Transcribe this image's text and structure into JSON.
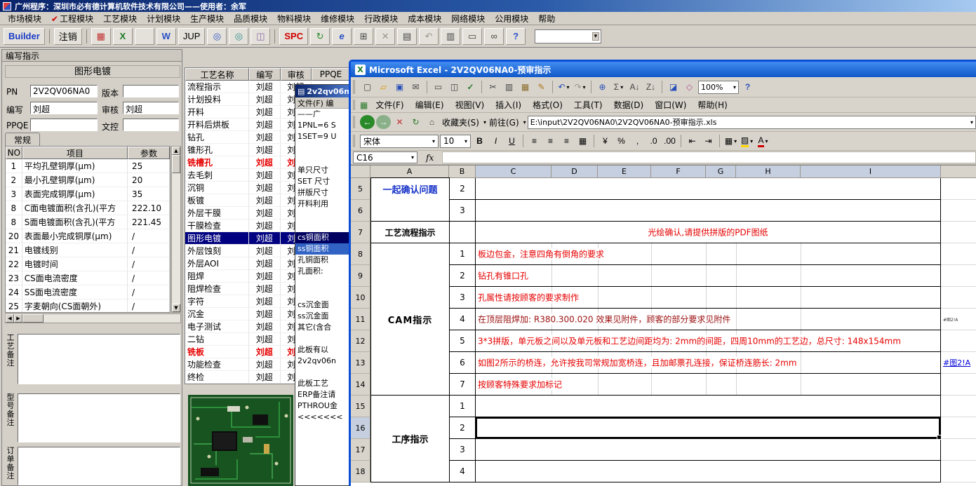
{
  "app": {
    "title": "广州程序：深圳市必有德计算机软件技术有限公司——使用者：余军",
    "menu_check": "✔",
    "menu": [
      {
        "label": "市场模块"
      },
      {
        "label": "工程模块",
        "checked": true
      },
      {
        "label": "工艺模块"
      },
      {
        "label": "计划模块"
      },
      {
        "label": "生产模块"
      },
      {
        "label": "品质模块"
      },
      {
        "label": "物料模块"
      },
      {
        "label": "维修模块"
      },
      {
        "label": "行政模块"
      },
      {
        "label": "成本模块"
      },
      {
        "label": "网络模块"
      },
      {
        "label": "公用模块"
      },
      {
        "label": "帮助"
      }
    ],
    "toolbar": {
      "items": [
        {
          "name": "builder-button",
          "text": "Builder",
          "color": "#1a3cc8",
          "bold": true
        },
        {
          "sep": true
        },
        {
          "name": "logout-button",
          "text": "注销"
        },
        {
          "sep": true
        },
        {
          "name": "grid-icon",
          "glyph": "▦",
          "color": "#c03030"
        },
        {
          "name": "excel-icon",
          "glyph": "X",
          "color": "#1a7a2a",
          "bold": true
        },
        {
          "name": "blank-icon",
          "glyph": ""
        },
        {
          "name": "word-icon",
          "glyph": "W",
          "color": "#2a50c8",
          "bold": true
        },
        {
          "name": "jup-button",
          "text": "JUP"
        },
        {
          "name": "preview-icon",
          "glyph": "◎",
          "color": "#2a50c8"
        },
        {
          "name": "view-icon",
          "glyph": "◎",
          "color": "#2a8a8a"
        },
        {
          "name": "column-icon",
          "glyph": "◫",
          "color": "#8a6aaa"
        },
        {
          "sep": true
        },
        {
          "name": "spc-button",
          "text": "SPC",
          "color": "#d00000",
          "bold": true
        },
        {
          "name": "refresh-icon",
          "glyph": "↻",
          "color": "#2a8a2a"
        },
        {
          "name": "ie-icon",
          "glyph": "e",
          "color": "#2a50c8",
          "bold": true,
          "italic": true
        },
        {
          "name": "calculator-icon",
          "glyph": "⊞",
          "color": "#444444"
        },
        {
          "name": "close-icon",
          "glyph": "✕",
          "color": "#9a968c"
        },
        {
          "name": "document-icon",
          "glyph": "▤",
          "color": "#444444"
        },
        {
          "name": "undo-icon",
          "glyph": "↶",
          "color": "#9a968c"
        },
        {
          "name": "sheet-icon",
          "glyph": "▥",
          "color": "#444444"
        },
        {
          "name": "print-icon",
          "glyph": "▭",
          "color": "#444444"
        },
        {
          "name": "find-icon",
          "glyph": "∞",
          "color": "#444444"
        },
        {
          "name": "help-icon",
          "glyph": "?",
          "color": "#2a50c8",
          "bold": true
        }
      ]
    }
  },
  "left_panel": {
    "caption": "编写指示",
    "group_title": "图形电镀",
    "fields": {
      "pn_label": "PN",
      "pn": "2V2QV06NA0",
      "version_label": "版本",
      "version": "",
      "writer_label": "编写",
      "writer": "刘超",
      "reviewer_label": "审核",
      "reviewer": "刘超",
      "ppqe_label": "PPQE",
      "ppqe": "",
      "doc_label": "文控",
      "doc": ""
    },
    "tab": "常规",
    "table": {
      "headers": [
        "NO",
        "项目",
        "参数"
      ],
      "rows": [
        [
          "1",
          "平均孔壁铜厚(μm)",
          "25"
        ],
        [
          "2",
          "最小孔壁铜厚(μm)",
          "20"
        ],
        [
          "3",
          "表面完成铜厚(μm)",
          "35"
        ],
        [
          "8",
          "C面电镀面积(含孔)(平方",
          "222.10"
        ],
        [
          "8",
          "S面电镀面积(含孔)(平方",
          "221.45"
        ],
        [
          "20",
          "表面最小完成铜厚(μm)",
          "/"
        ],
        [
          "21",
          "电镀线别",
          "/"
        ],
        [
          "22",
          "电镀时间",
          "/"
        ],
        [
          "23",
          "CS面电流密度",
          "/"
        ],
        [
          "24",
          "SS面电流密度",
          "/"
        ],
        [
          "25",
          "字麦朝向(CS面朝外)",
          "/"
        ]
      ]
    },
    "remarks": [
      {
        "label": "工艺备注"
      },
      {
        "label": "型号备注"
      },
      {
        "label": "订单备注"
      }
    ]
  },
  "process_table": {
    "headers": [
      "工艺名称",
      "编写",
      "审核",
      "PPQE"
    ],
    "rows": [
      {
        "name": "流程指示",
        "w": "刘超",
        "r": "刘超"
      },
      {
        "name": "计划投料",
        "w": "刘超",
        "r": "刘超"
      },
      {
        "name": "开料",
        "w": "刘超",
        "r": "刘超"
      },
      {
        "name": "开料后烘板",
        "w": "刘超",
        "r": "刘超"
      },
      {
        "name": "钻孔",
        "w": "刘超",
        "r": "刘超"
      },
      {
        "name": "锥形孔",
        "w": "刘超",
        "r": "刘超"
      },
      {
        "name": "铣槽孔",
        "w": "刘超",
        "r": "刘超",
        "red": true
      },
      {
        "name": "去毛刺",
        "w": "刘超",
        "r": "刘超"
      },
      {
        "name": "沉铜",
        "w": "刘超",
        "r": "刘超"
      },
      {
        "name": "板镀",
        "w": "刘超",
        "r": "刘超"
      },
      {
        "name": "外层干膜",
        "w": "刘超",
        "r": "刘超"
      },
      {
        "name": "干膜检查",
        "w": "刘超",
        "r": "刘超"
      },
      {
        "name": "图形电镀",
        "w": "刘超",
        "r": "刘超",
        "selected": true
      },
      {
        "name": "外层蚀刻",
        "w": "刘超",
        "r": "刘超"
      },
      {
        "name": "外层AOI",
        "w": "刘超",
        "r": "刘超"
      },
      {
        "name": "阻焊",
        "w": "刘超",
        "r": "刘超"
      },
      {
        "name": "阻焊检查",
        "w": "刘超",
        "r": "刘超"
      },
      {
        "name": "字符",
        "w": "刘超",
        "r": "刘超"
      },
      {
        "name": "沉金",
        "w": "刘超",
        "r": "刘超"
      },
      {
        "name": "电子测试",
        "w": "刘超",
        "r": "刘超"
      },
      {
        "name": "二钻",
        "w": "刘超",
        "r": "刘超"
      },
      {
        "name": "铣板",
        "w": "刘超",
        "r": "刘超",
        "red": true
      },
      {
        "name": "功能检查",
        "w": "刘超",
        "r": "刘超"
      },
      {
        "name": "终检",
        "w": "刘超",
        "r": "刘超"
      }
    ]
  },
  "notepad": {
    "title": "2v2qv06n",
    "menu": "文件(F) 编",
    "lines": [
      {
        "t": "——广"
      },
      {
        "t": "1PNL=6 S"
      },
      {
        "t": "1SET=9 U"
      },
      {
        "t": ""
      },
      {
        "t": ""
      },
      {
        "t": "单只尺寸"
      },
      {
        "t": "SET 尺寸"
      },
      {
        "t": "拼版尺寸"
      },
      {
        "t": "开料利用"
      },
      {
        "t": ""
      },
      {
        "t": ""
      },
      {
        "t": "cs铜面积",
        "hl": "dark"
      },
      {
        "t": "ss铜面积",
        "hl": "blue"
      },
      {
        "t": "孔铜面积"
      },
      {
        "t": "孔面积:"
      },
      {
        "t": ""
      },
      {
        "t": ""
      },
      {
        "t": "cs沉金面"
      },
      {
        "t": "ss沉金面"
      },
      {
        "t": "其它(含合"
      },
      {
        "t": ""
      },
      {
        "t": "此板有以"
      },
      {
        "t": "2v2qv06n"
      },
      {
        "t": ""
      },
      {
        "t": "此板工艺"
      },
      {
        "t": "ERP备注请"
      },
      {
        "t": "PTHROU金"
      },
      {
        "t": "<<<<<<<"
      }
    ]
  },
  "excel": {
    "title": "Microsoft Excel - 2V2QV06NA0-预审指示",
    "menu": [
      "文件(F)",
      "编辑(E)",
      "视图(V)",
      "插入(I)",
      "格式(O)",
      "工具(T)",
      "数据(D)",
      "窗口(W)",
      "帮助(H)"
    ],
    "zoom": "100%",
    "std_icons": [
      {
        "name": "new-document-icon",
        "glyph": "▢",
        "color": "#444444"
      },
      {
        "name": "open-folder-icon",
        "glyph": "▱",
        "color": "#d89a00"
      },
      {
        "name": "save-icon",
        "glyph": "▣",
        "color": "#2a50b8"
      },
      {
        "name": "email-icon",
        "glyph": "✉",
        "color": "#444444"
      },
      {
        "sep": true
      },
      {
        "name": "print-icon",
        "glyph": "▭",
        "color": "#444444"
      },
      {
        "name": "print-preview-icon",
        "glyph": "◫",
        "color": "#444444"
      },
      {
        "name": "spelling-icon",
        "glyph": "✓",
        "color": "#2a7a2a",
        "bold": true
      },
      {
        "sep": true
      },
      {
        "name": "cut-icon",
        "glyph": "✂",
        "color": "#444444"
      },
      {
        "name": "copy-icon",
        "glyph": "▥",
        "color": "#444444"
      },
      {
        "name": "paste-icon",
        "glyph": "▦",
        "color": "#8a6a2a"
      },
      {
        "name": "format-painter-icon",
        "glyph": "✎",
        "color": "#b07820"
      },
      {
        "sep": true
      },
      {
        "name": "undo-icon",
        "glyph": "↶",
        "color": "#2a50b8",
        "caret": true
      },
      {
        "name": "redo-icon",
        "glyph": "↷",
        "color": "#9a968c",
        "caret": true
      },
      {
        "sep": true
      },
      {
        "name": "hyperlink-icon",
        "glyph": "⊕",
        "color": "#2a50b8"
      },
      {
        "name": "autosum-icon",
        "glyph": "Σ",
        "color": "#444444",
        "caret": true
      },
      {
        "name": "sort-ascending-icon",
        "glyph": "A↓",
        "color": "#444444"
      },
      {
        "name": "sort-descending-icon",
        "glyph": "Z↓",
        "color": "#444444"
      },
      {
        "sep": true
      },
      {
        "name": "chart-wizard-icon",
        "glyph": "◪",
        "color": "#2a50b8"
      },
      {
        "name": "drawing-icon",
        "glyph": "◇",
        "color": "#b05090"
      },
      {
        "zoom": true
      },
      {
        "name": "help-icon",
        "glyph": "?",
        "color": "#2a50b8",
        "bold": true
      }
    ],
    "web": {
      "icons": [
        {
          "name": "back-icon",
          "glyph": "←",
          "bg": "#2a8a2a"
        },
        {
          "name": "forward-icon",
          "glyph": "→",
          "bg": "#8ab08a"
        },
        {
          "name": "stop-icon",
          "glyph": "✕",
          "color": "#c03030"
        },
        {
          "name": "refresh-icon",
          "glyph": "↻",
          "color": "#2a7a2a"
        },
        {
          "name": "home-icon",
          "glyph": "⌂",
          "color": "#444444"
        }
      ],
      "favorites": "收藏夹(S)",
      "go": "前往(G)",
      "address": "E:\\input\\2V2QV06NA0\\2V2QV06NA0-预审指示.xls"
    },
    "fmt": {
      "font": "宋体",
      "size": "10",
      "buttons": [
        {
          "name": "bold-button",
          "glyph": "B",
          "bold": true
        },
        {
          "name": "italic-button",
          "glyph": "I",
          "italic": true
        },
        {
          "name": "underline-button",
          "glyph": "U",
          "u": true
        },
        {
          "sep": true
        },
        {
          "name": "align-left-icon",
          "glyph": "≡"
        },
        {
          "name": "align-center-icon",
          "glyph": "≡"
        },
        {
          "name": "align-right-icon",
          "glyph": "≡"
        },
        {
          "name": "merge-center-icon",
          "glyph": "▦"
        },
        {
          "sep": true
        },
        {
          "name": "currency-icon",
          "glyph": "¥"
        },
        {
          "name": "percent-icon",
          "glyph": "%"
        },
        {
          "name": "comma-icon",
          "glyph": ","
        },
        {
          "name": "increase-decimal-icon",
          "glyph": ".0"
        },
        {
          "name": "decrease-decimal-icon",
          "glyph": ".00"
        },
        {
          "sep": true
        },
        {
          "name": "decrease-indent-icon",
          "glyph": "⇤"
        },
        {
          "name": "increase-indent-icon",
          "glyph": "⇥"
        },
        {
          "sep": true
        },
        {
          "name": "borders-icon",
          "glyph": "▦",
          "caret": true
        },
        {
          "name": "fill-color-icon",
          "glyph": "▨",
          "ul": "#ffd400",
          "caret": true
        },
        {
          "name": "font-color-icon",
          "glyph": "A",
          "ul": "#d00000",
          "caret": true
        }
      ]
    },
    "name_box": "C16",
    "fx_label": "fx",
    "columns": [
      "A",
      "B",
      "C",
      "D",
      "E",
      "F",
      "G",
      "H",
      "I"
    ],
    "a_blocks": {
      "confirm": "一起确认问题",
      "flow": "工艺流程指示",
      "cam": "CAM指示",
      "process": "工序指示"
    },
    "rows": [
      {
        "n": "5",
        "b": "2"
      },
      {
        "n": "6",
        "b": "3"
      },
      {
        "n": "7",
        "text": "光绘确认,请提供拼版的PDF图纸",
        "align": "center",
        "color": "#e60000"
      },
      {
        "n": "8",
        "b": "1",
        "sep": true,
        "text": "板边包金，注意四角有倒角的要求",
        "color": "#e60000"
      },
      {
        "n": "9",
        "b": "2",
        "sep": true,
        "text": "钻孔有锥口孔",
        "color": "#e60000"
      },
      {
        "n": "10",
        "b": "3",
        "sep": true,
        "text": "孔属性请按顾客的要求制作",
        "color": "#e60000"
      },
      {
        "n": "11",
        "b": "4",
        "sep": true,
        "text": "在顶层阻焊加: R380.300.020 效果见附件，顾客的部分要求见附件",
        "color": "#9b1010",
        "frag": "#图2!A"
      },
      {
        "n": "12",
        "b": "5",
        "sep": true,
        "text": "3*3拼版，单元板之间以及单元板和工艺边间距均为: 2mm的间距，四周10mm的工艺边，总尺寸: 148x154mm",
        "color": "#e60000"
      },
      {
        "n": "13",
        "b": "6",
        "sep": true,
        "text": "如图2所示的桥连，允许按我司常规加宽桥连，且加邮票孔连接，保证桥连筋长: 2mm",
        "color": "#e60000",
        "link": "#图2!A"
      },
      {
        "n": "14",
        "b": "7",
        "sep": true,
        "text": "按顾客特殊要求加标记",
        "color": "#e60000"
      },
      {
        "n": "15",
        "b": "1"
      },
      {
        "n": "16",
        "b": "2",
        "selected": true
      },
      {
        "n": "17",
        "b": "3"
      },
      {
        "n": "18",
        "b": "4"
      }
    ]
  }
}
